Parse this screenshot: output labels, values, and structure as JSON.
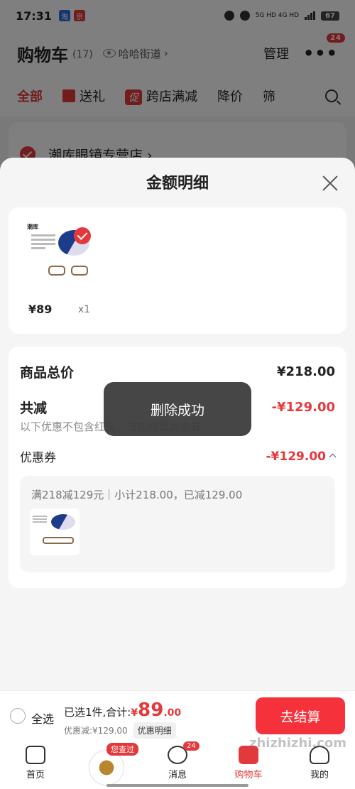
{
  "status_bar": {
    "time": "17:31",
    "network": "5G HD  4G HD",
    "battery": "67"
  },
  "header": {
    "title": "购物车",
    "count": "(17)",
    "location": "哈哈街道",
    "manage": "管理",
    "more_badge": "24"
  },
  "tabs": [
    {
      "label": "全部"
    },
    {
      "label": "送礼"
    },
    {
      "label": "跨店满减"
    },
    {
      "label": "降价"
    },
    {
      "label": "筛"
    }
  ],
  "promo_icon_text": "促",
  "store": {
    "name": "潮库眼镜专营店 ›"
  },
  "sheet": {
    "title": "金额明细",
    "product": {
      "brand": "潮库",
      "price": "¥89",
      "qty": "x1"
    },
    "total_label": "商品总价",
    "total_value": "¥218.00",
    "discount_label": "共减",
    "discount_value": "-¥129.00",
    "discount_note": "以下优惠不包含红包，请在结算页查看",
    "coupon_label": "优惠券",
    "coupon_value": "-¥129.00",
    "coupon_desc": "满218减129元｜小计218.00，已减129.00"
  },
  "toast": "删除成功",
  "checkout": {
    "select_all": "全选",
    "summary_prefix": "已选1件,合计:",
    "currency": "¥",
    "amount_int": "89",
    "amount_dec": ".00",
    "discount_text": "优惠减:¥129.00",
    "detail_button": "优惠明细",
    "checkout_button": "去结算"
  },
  "nav": [
    {
      "label": "首页"
    },
    {
      "label": "",
      "tag": "您查过"
    },
    {
      "label": "消息",
      "badge": "24"
    },
    {
      "label": "购物车"
    },
    {
      "label": "我的"
    }
  ],
  "watermark": "zhizhizhi.com",
  "colors": {
    "accent": "#e4393c"
  }
}
